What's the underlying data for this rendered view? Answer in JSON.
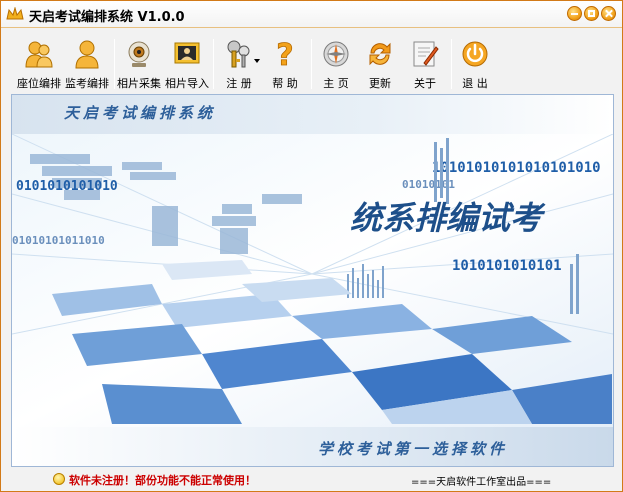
{
  "window": {
    "title": "天启考试编排系统 V1.0.0"
  },
  "toolbar": {
    "items": [
      {
        "label": "座位编排",
        "icon": "seat-arrangement-icon"
      },
      {
        "label": "监考编排",
        "icon": "proctor-arrangement-icon"
      },
      {
        "label": "相片采集",
        "icon": "photo-capture-icon"
      },
      {
        "label": "相片导入",
        "icon": "photo-import-icon"
      },
      {
        "label": "注 册",
        "icon": "register-key-icon"
      },
      {
        "label": "帮 助",
        "icon": "help-icon"
      },
      {
        "label": "主 页",
        "icon": "homepage-icon"
      },
      {
        "label": "更新",
        "icon": "update-icon"
      },
      {
        "label": "关于",
        "icon": "about-icon"
      },
      {
        "label": "退 出",
        "icon": "exit-icon"
      }
    ]
  },
  "banner": {
    "top_text": "天启考试编排系统",
    "hero_text": "统系排编试考",
    "binary_1": "0101010101010",
    "binary_2": "10101010101010101010",
    "binary_3": "01010101011010",
    "binary_4": "1010101010101",
    "binary_5": "01010101",
    "bottom_text": "学校考试第一选择软件"
  },
  "status": {
    "warning": "软件未注册！部份功能不能正常使用！",
    "credit": "===天启软件工作室出品==="
  },
  "colors": {
    "frame_border": "#d27a18",
    "banner_text": "#2d5f9a",
    "warning_text": "#cc0000"
  }
}
